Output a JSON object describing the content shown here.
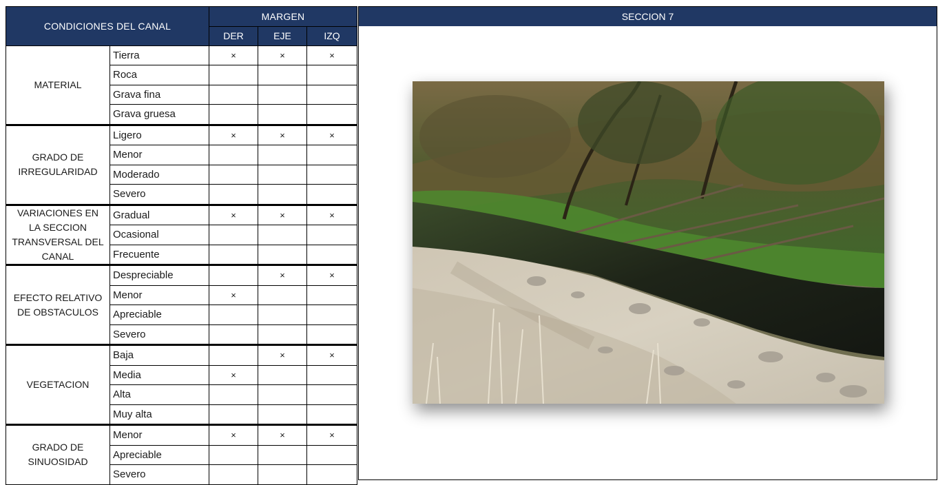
{
  "header": {
    "conditions_title": "CONDICIONES DEL CANAL",
    "margin_title": "MARGEN",
    "columns": [
      "DER",
      "EJE",
      "IZQ"
    ]
  },
  "mark_symbol": "×",
  "groups": [
    {
      "category_lines": [
        "MATERIAL"
      ],
      "rows": [
        {
          "option": "Tierra",
          "der": "×",
          "eje": "×",
          "izq": "×"
        },
        {
          "option": "Roca",
          "der": "",
          "eje": "",
          "izq": ""
        },
        {
          "option": "Grava fina",
          "der": "",
          "eje": "",
          "izq": ""
        },
        {
          "option": "Grava gruesa",
          "der": "",
          "eje": "",
          "izq": ""
        }
      ]
    },
    {
      "category_lines": [
        "GRADO DE",
        "IRREGULARIDAD"
      ],
      "rows": [
        {
          "option": "Ligero",
          "der": "×",
          "eje": "×",
          "izq": "×"
        },
        {
          "option": "Menor",
          "der": "",
          "eje": "",
          "izq": ""
        },
        {
          "option": "Moderado",
          "der": "",
          "eje": "",
          "izq": ""
        },
        {
          "option": "Severo",
          "der": "",
          "eje": "",
          "izq": ""
        }
      ]
    },
    {
      "category_lines": [
        "VARIACIONES EN",
        "LA SECCION",
        "TRANSVERSAL DEL",
        "CANAL"
      ],
      "rows": [
        {
          "option": "Gradual",
          "der": "×",
          "eje": "×",
          "izq": "×"
        },
        {
          "option": "Ocasional",
          "der": "",
          "eje": "",
          "izq": ""
        },
        {
          "option": "Frecuente",
          "der": "",
          "eje": "",
          "izq": ""
        }
      ]
    },
    {
      "category_lines": [
        "EFECTO RELATIVO",
        "DE OBSTACULOS"
      ],
      "rows": [
        {
          "option": "Despreciable",
          "der": "",
          "eje": "×",
          "izq": "×"
        },
        {
          "option": "Menor",
          "der": "×",
          "eje": "",
          "izq": ""
        },
        {
          "option": "Apreciable",
          "der": "",
          "eje": "",
          "izq": ""
        },
        {
          "option": "Severo",
          "der": "",
          "eje": "",
          "izq": ""
        }
      ]
    },
    {
      "category_lines": [
        "VEGETACION"
      ],
      "rows": [
        {
          "option": "Baja",
          "der": "",
          "eje": "×",
          "izq": "×"
        },
        {
          "option": "Media",
          "der": "×",
          "eje": "",
          "izq": ""
        },
        {
          "option": "Alta",
          "der": "",
          "eje": "",
          "izq": ""
        },
        {
          "option": "Muy alta",
          "der": "",
          "eje": "",
          "izq": ""
        }
      ]
    },
    {
      "category_lines": [
        "GRADO DE",
        "SINUOSIDAD"
      ],
      "rows": [
        {
          "option": "Menor",
          "der": "×",
          "eje": "×",
          "izq": "×"
        },
        {
          "option": "Apreciable",
          "der": "",
          "eje": "",
          "izq": ""
        },
        {
          "option": "Severo",
          "der": "",
          "eje": "",
          "izq": ""
        }
      ]
    }
  ],
  "section": {
    "title": "SECCION 7"
  },
  "colors": {
    "header_bg": "#203864",
    "header_text": "#ffffff",
    "border": "#000000"
  }
}
